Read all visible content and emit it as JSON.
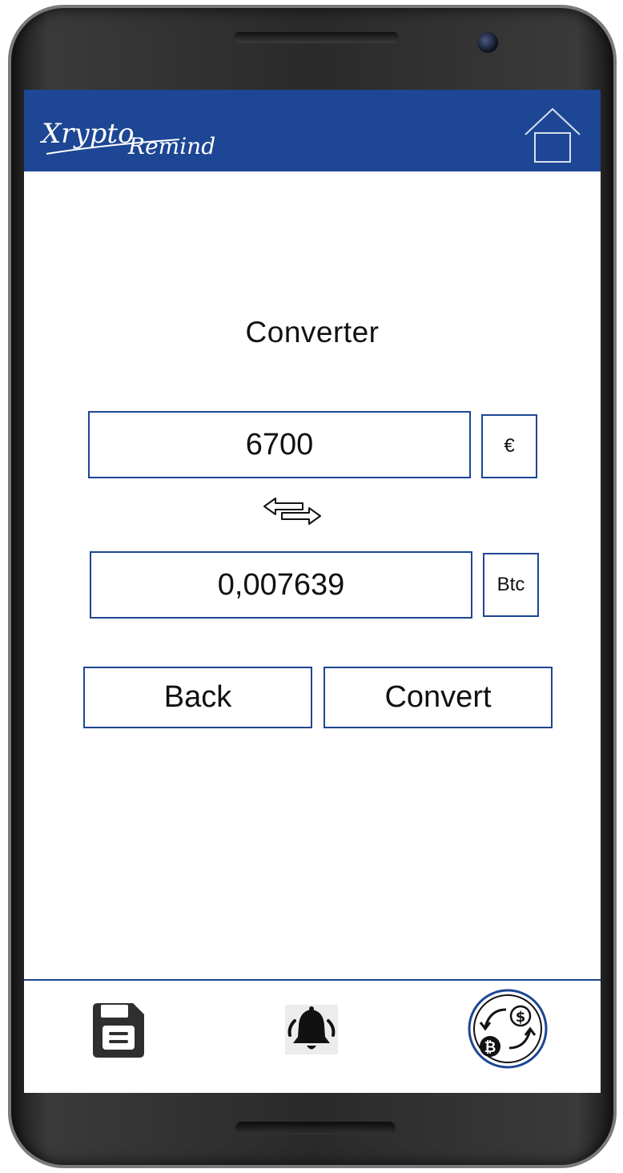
{
  "header": {
    "logo_text": "XryptoRemind",
    "home_icon": "home-icon",
    "brand_color": "#1d4694"
  },
  "converter": {
    "title": "Converter",
    "fiat_amount": "6700",
    "fiat_unit": "€",
    "crypto_amount": "0,007639",
    "crypto_unit": "Btc",
    "swap_icon": "swap-arrows-icon"
  },
  "actions": {
    "back_label": "Back",
    "convert_label": "Convert"
  },
  "bottom_nav": {
    "items": [
      {
        "icon": "save-icon"
      },
      {
        "icon": "bell-icon"
      },
      {
        "icon": "currency-exchange-icon"
      }
    ]
  }
}
